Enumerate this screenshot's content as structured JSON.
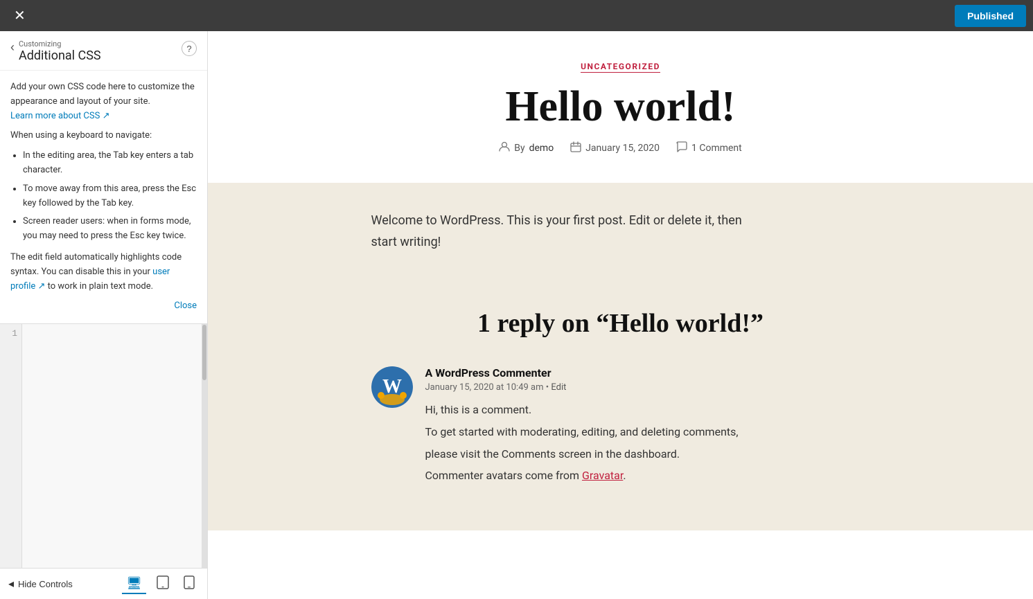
{
  "topbar": {
    "close_icon": "✕",
    "published_label": "Published"
  },
  "sidebar": {
    "back_icon": "‹",
    "customizing_label": "Customizing",
    "section_title": "Additional CSS",
    "help_icon": "?",
    "description": "Add your own CSS code here to customize the appearance and layout of your site.",
    "learn_more_label": "Learn more about CSS",
    "learn_more_icon": "↗",
    "keyboard_nav_title": "When using a keyboard to navigate:",
    "keyboard_items": [
      "In the editing area, the Tab key enters a tab character.",
      "To move away from this area, press the Esc key followed by the Tab key.",
      "Screen reader users: when in forms mode, you may need to press the Esc key twice."
    ],
    "edit_field_note": "The edit field automatically highlights code syntax. You can disable this in your",
    "user_profile_label": "user profile",
    "user_profile_icon": "↗",
    "plain_text_suffix": "to work in plain text mode.",
    "close_label": "Close",
    "line_number": "1",
    "css_placeholder": ""
  },
  "bottom_controls": {
    "hide_controls_icon": "◂",
    "hide_controls_label": "Hide Controls",
    "device_desktop_icon": "🖥",
    "device_tablet_icon": "▭",
    "device_mobile_icon": "📱"
  },
  "preview": {
    "category": "UNCATEGORIZED",
    "post_title": "Hello world!",
    "meta_author_prefix": "By",
    "meta_author": "demo",
    "meta_date": "January 15, 2020",
    "meta_comment_count": "1 Comment",
    "post_content_line1": "Welcome to WordPress. This is your first post. Edit or delete it, then",
    "post_content_line2": "start writing!",
    "replies_title": "1 reply on “Hello world!”",
    "commenter_name": "A WordPress Commenter",
    "comment_date": "January 15, 2020 at 10:49 am",
    "comment_bullet": "•",
    "comment_edit": "Edit",
    "comment_line1": "Hi, this is a comment.",
    "comment_line2": "To get started with moderating, editing, and deleting comments,",
    "comment_line3": "please visit the Comments screen in the dashboard.",
    "comment_line4": "Commenter avatars come from",
    "gravatar_label": "Gravatar",
    "comment_period": "."
  }
}
